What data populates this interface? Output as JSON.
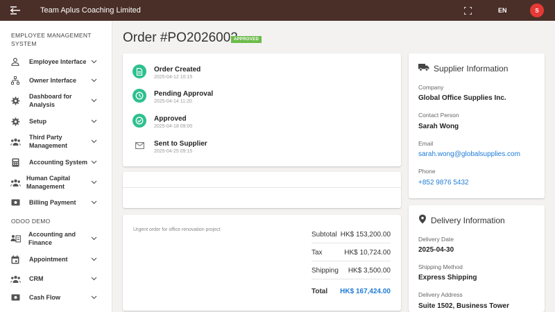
{
  "app": {
    "title": "Team Aplus Coaching Limited",
    "lang": "EN",
    "avatar_initial": "S",
    "avatar_color": "#e53935",
    "bar_color": "#4a2f28"
  },
  "sidebar": {
    "section1": "EMPLOYEE MANAGEMENT SYSTEM",
    "items1": [
      {
        "label": "Employee Interface",
        "icon": "person-icon"
      },
      {
        "label": "Owner Interface",
        "icon": "org-chart-icon"
      },
      {
        "label": "Dashboard for Analysis",
        "icon": "gear-icon"
      },
      {
        "label": "Setup",
        "icon": "gear-icon"
      },
      {
        "label": "Third Party Management",
        "icon": "group-icon"
      },
      {
        "label": "Accounting System",
        "icon": "calculator-icon"
      },
      {
        "label": "Human Capital Management",
        "icon": "group-icon"
      },
      {
        "label": "Billing Payment",
        "icon": "money-icon"
      }
    ],
    "section2": "ODOO DEMO",
    "items2": [
      {
        "label": "Accounting and Finance",
        "icon": "id-card-icon"
      },
      {
        "label": "Appointment",
        "icon": "calendar-icon"
      },
      {
        "label": "CRM",
        "icon": "group-icon"
      },
      {
        "label": "Cash Flow",
        "icon": "money-icon"
      }
    ]
  },
  "order": {
    "title": "Order #PO2026002",
    "status": "APPROVED",
    "status_color": "#6dbb4b"
  },
  "timeline": [
    {
      "label": "Order Created",
      "time": "2025-04-12 10:15",
      "icon": "document-icon",
      "done": true
    },
    {
      "label": "Pending Approval",
      "time": "2025-04-14 11:20",
      "icon": "clock-icon",
      "done": true
    },
    {
      "label": "Approved",
      "time": "2025-04-18 09:00",
      "icon": "check-circle-icon",
      "done": true
    },
    {
      "label": "Sent to Supplier",
      "time": "2025-04-25 09:15",
      "icon": "mail-icon",
      "done": false
    }
  ],
  "summary": {
    "note": "Urgent order for office renovation project",
    "rows": [
      {
        "label": "Subtotal",
        "value": "HK$ 153,200.00"
      },
      {
        "label": "Tax",
        "value": "HK$ 10,724.00"
      },
      {
        "label": "Shipping",
        "value": "HK$ 3,500.00"
      },
      {
        "label": "Total",
        "value": "HK$ 167,424.00"
      }
    ]
  },
  "supplier": {
    "heading": "Supplier Information",
    "icon": "truck-icon",
    "fields": [
      {
        "label": "Company",
        "value": "Global Office Supplies Inc."
      },
      {
        "label": "Contact Person",
        "value": "Sarah Wong"
      },
      {
        "label": "Email",
        "value": "sarah.wong@globalsupplies.com"
      },
      {
        "label": "Phone",
        "value": "+852 9876 5432"
      }
    ]
  },
  "delivery": {
    "heading": "Delivery Information",
    "icon": "location-pin-icon",
    "fields": [
      {
        "label": "Delivery Date",
        "value": "2025-04-30"
      },
      {
        "label": "Shipping Method",
        "value": "Express Shipping"
      },
      {
        "label": "Delivery Address",
        "value": "Suite 1502, Business Tower"
      }
    ]
  }
}
